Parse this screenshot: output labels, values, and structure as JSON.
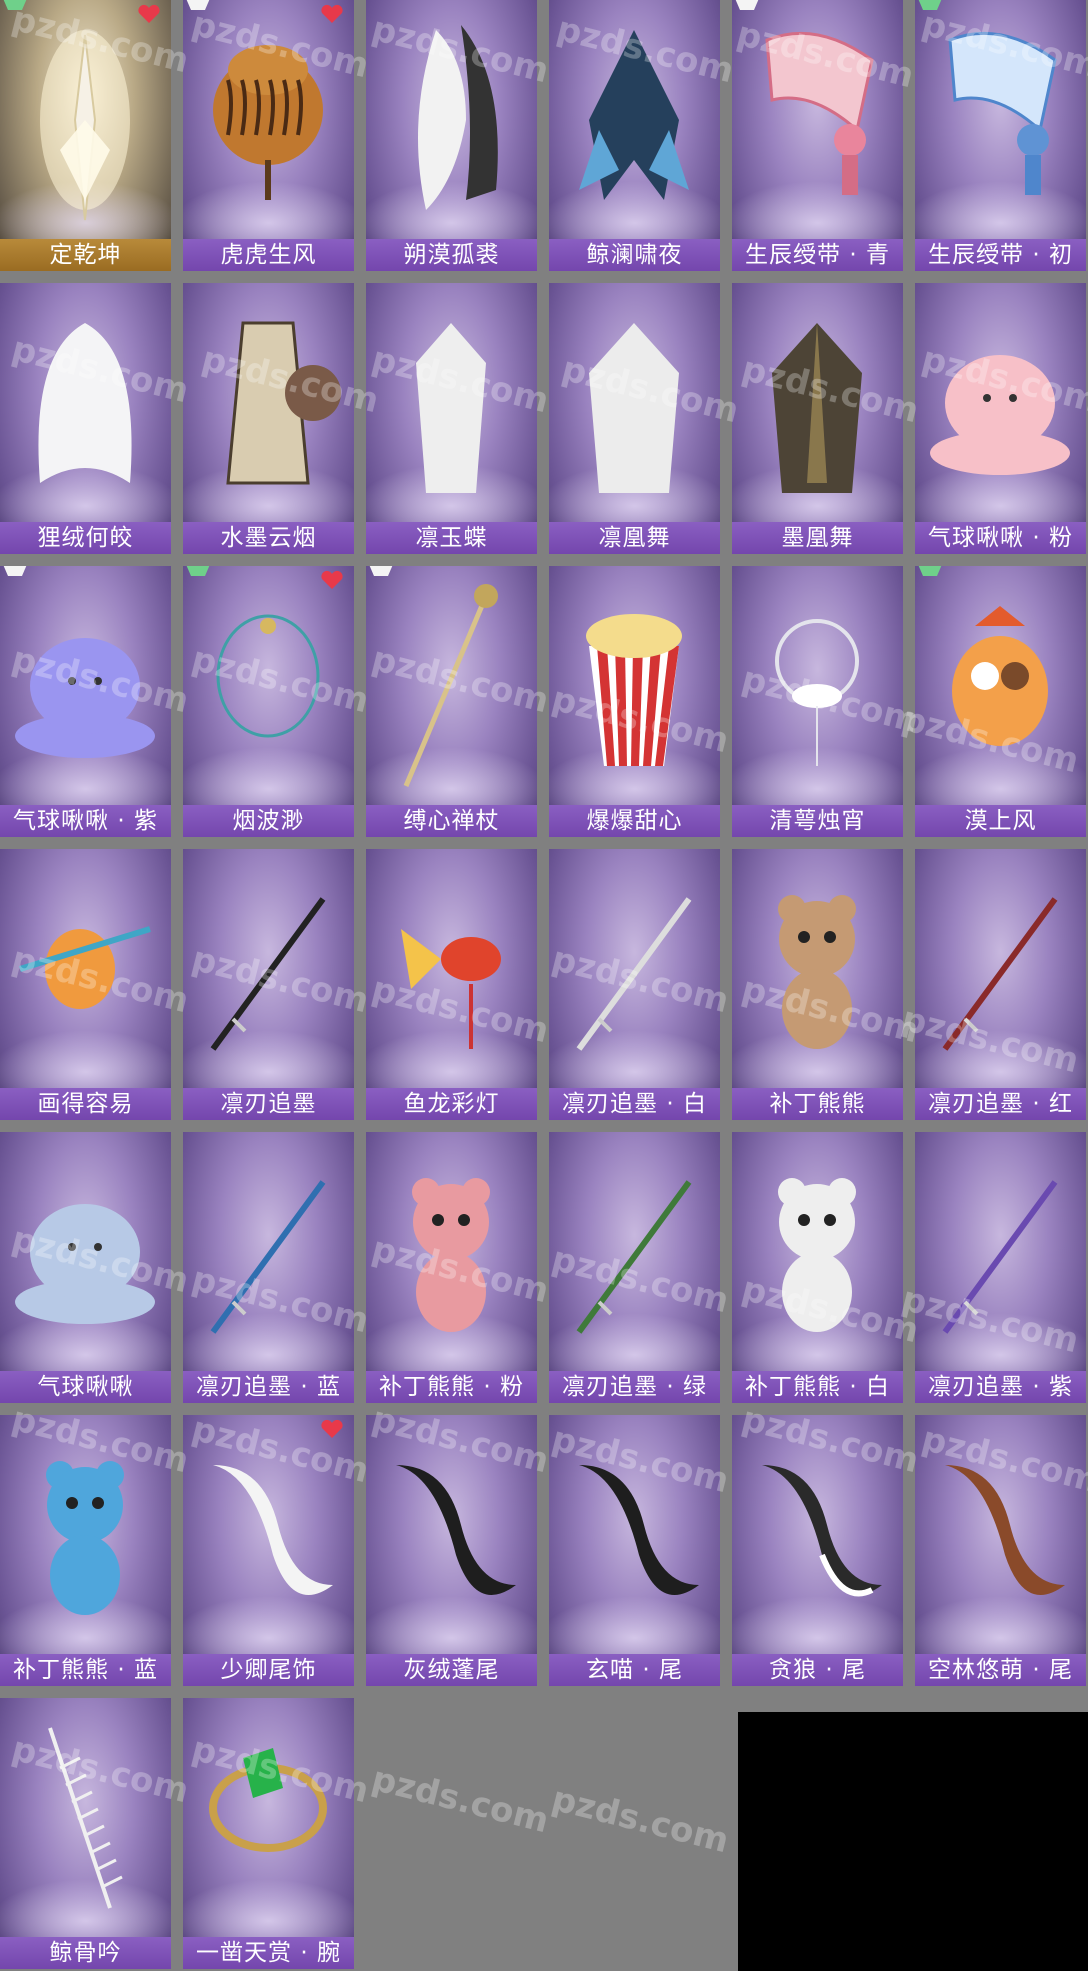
{
  "watermark": "pzds.com",
  "items": [
    {
      "name": "定乾坤",
      "art": "sword-glow-art",
      "style": "gold",
      "badge": "heart",
      "corner": "green"
    },
    {
      "name": "虎虎生风",
      "art": "tiger-costume-art",
      "badge": "heart",
      "corner": "white"
    },
    {
      "name": "朔漠孤裘",
      "art": "white-fur-cloak-art"
    },
    {
      "name": "鲸澜啸夜",
      "art": "blue-feather-coat-art"
    },
    {
      "name": "生辰绶带 · 青",
      "art": "pink-sash-art",
      "corner": "white"
    },
    {
      "name": "生辰绶带 · 初",
      "art": "blue-sash-art",
      "corner": "green"
    },
    {
      "name": "狸绒何皎",
      "art": "white-hair-art"
    },
    {
      "name": "水墨云烟",
      "art": "ink-robe-art"
    },
    {
      "name": "凛玉蝶",
      "art": "white-butterfly-robe-art"
    },
    {
      "name": "凛凰舞",
      "art": "white-phoenix-robe-art"
    },
    {
      "name": "墨凰舞",
      "art": "dark-phoenix-robe-art"
    },
    {
      "name": "气球啾啾 · 粉",
      "art": "pink-balloon-art"
    },
    {
      "name": "气球啾啾 · 紫",
      "art": "purple-balloon-art",
      "corner": "white"
    },
    {
      "name": "烟波渺",
      "art": "necklace-art",
      "badge": "heart",
      "corner": "green"
    },
    {
      "name": "缚心禅杖",
      "art": "staff-art",
      "corner": "white"
    },
    {
      "name": "爆爆甜心",
      "art": "popcorn-art"
    },
    {
      "name": "清萼烛宵",
      "art": "lotus-ring-art"
    },
    {
      "name": "漠上风",
      "art": "owl-art",
      "corner": "green"
    },
    {
      "name": "画得容易",
      "art": "fox-brush-art"
    },
    {
      "name": "凛刃追墨",
      "art": "black-sword-art"
    },
    {
      "name": "鱼龙彩灯",
      "art": "goldfish-lantern-art"
    },
    {
      "name": "凛刃追墨 · 白",
      "art": "white-sword-art"
    },
    {
      "name": "补丁熊熊",
      "art": "brown-bear-art"
    },
    {
      "name": "凛刃追墨 · 红",
      "art": "red-sword-art"
    },
    {
      "name": "气球啾啾",
      "art": "blue-balloon-art"
    },
    {
      "name": "凛刃追墨 · 蓝",
      "art": "blue-sword-art"
    },
    {
      "name": "补丁熊熊 · 粉",
      "art": "pink-bear-art"
    },
    {
      "name": "凛刃追墨 · 绿",
      "art": "green-sword-art"
    },
    {
      "name": "补丁熊熊 · 白",
      "art": "white-bear-art"
    },
    {
      "name": "凛刃追墨 · 紫",
      "art": "purple-sword-art"
    },
    {
      "name": "补丁熊熊 · 蓝",
      "art": "cyan-bear-art"
    },
    {
      "name": "少卿尾饰",
      "art": "white-tail-art",
      "badge": "heart"
    },
    {
      "name": "灰绒蓬尾",
      "art": "black-tail-art"
    },
    {
      "name": "玄喵 · 尾",
      "art": "cat-tail-art"
    },
    {
      "name": "贪狼 · 尾",
      "art": "skunk-tail-art"
    },
    {
      "name": "空林悠萌 · 尾",
      "art": "raccoon-tail-art"
    },
    {
      "name": "鲸骨吟",
      "art": "bone-hairpin-art"
    },
    {
      "name": "一凿天赏 · 腕",
      "art": "emerald-bracelet-art"
    }
  ]
}
